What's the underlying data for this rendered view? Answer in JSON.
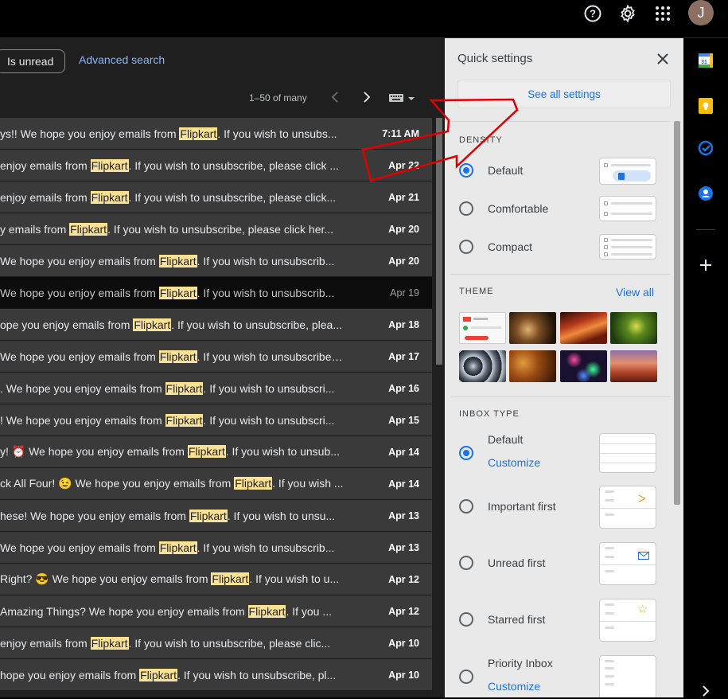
{
  "toolbar": {
    "filter_chip": "Is unread",
    "advanced_search": "Advanced search",
    "pager": "1–50 of many",
    "account_initial": "J"
  },
  "emails": [
    {
      "snippet_pre": "ys!! We hope you enjoy emails from ",
      "brand": "Flipkart",
      "snippet_post": ". If you wish to unsubs...",
      "date": "7:11 AM",
      "read": false
    },
    {
      "snippet_pre": "enjoy emails from ",
      "brand": "Flipkart",
      "snippet_post": ". If you wish to unsubscribe, please click ...",
      "date": "Apr 22",
      "read": false
    },
    {
      "snippet_pre": "enjoy emails from ",
      "brand": "Flipkart",
      "snippet_post": ". If you wish to unsubscribe, please click...",
      "date": "Apr 21",
      "read": false
    },
    {
      "snippet_pre": "y emails from ",
      "brand": "Flipkart",
      "snippet_post": ". If you wish to unsubscribe, please click her...",
      "date": "Apr 20",
      "read": false
    },
    {
      "snippet_pre": "We hope you enjoy emails from ",
      "brand": "Flipkart",
      "snippet_post": ". If you wish to unsubscrib...",
      "date": "Apr 20",
      "read": false
    },
    {
      "snippet_pre": " We hope you enjoy emails from ",
      "brand": "Flipkart",
      "snippet_post": ". If you wish to unsubscrib...",
      "date": "Apr 19",
      "read": true
    },
    {
      "snippet_pre": "ope you enjoy emails from ",
      "brand": "Flipkart",
      "snippet_post": ". If you wish to unsubscribe, plea...",
      "date": "Apr 18",
      "read": false
    },
    {
      "snippet_pre": "We hope you enjoy emails from ",
      "brand": "Flipkart",
      "snippet_post": ". If you wish to unsubscribe,...",
      "date": "Apr 17",
      "read": false
    },
    {
      "snippet_pre": ". We hope you enjoy emails from ",
      "brand": "Flipkart",
      "snippet_post": ". If you wish to unsubscri...",
      "date": "Apr 16",
      "read": false
    },
    {
      "snippet_pre": "! We hope you enjoy emails from ",
      "brand": "Flipkart",
      "snippet_post": ". If you wish to unsubscri...",
      "date": "Apr 15",
      "read": false
    },
    {
      "snippet_pre": "y! ⏰ We hope you enjoy emails from ",
      "brand": "Flipkart",
      "snippet_post": ". If you wish to unsub...",
      "date": "Apr 14",
      "read": false
    },
    {
      "snippet_pre": "ck All Four! 😉 We hope you enjoy emails from ",
      "brand": "Flipkart",
      "snippet_post": ". If you wish ...",
      "date": "Apr 14",
      "read": false
    },
    {
      "snippet_pre": "hese! We hope you enjoy emails from ",
      "brand": "Flipkart",
      "snippet_post": ". If you wish to unsu...",
      "date": "Apr 13",
      "read": false
    },
    {
      "snippet_pre": "We hope you enjoy emails from ",
      "brand": "Flipkart",
      "snippet_post": ". If you wish to unsubscrib...",
      "date": "Apr 13",
      "read": false
    },
    {
      "snippet_pre": " Right? 😎 We hope you enjoy emails from ",
      "brand": "Flipkart",
      "snippet_post": ". If you wish to u...",
      "date": "Apr 12",
      "read": false
    },
    {
      "snippet_pre": " Amazing Things? We hope you enjoy emails from ",
      "brand": "Flipkart",
      "snippet_post": ". If you ...",
      "date": "Apr 12",
      "read": false
    },
    {
      "snippet_pre": " enjoy emails from ",
      "brand": "Flipkart",
      "snippet_post": ". If you wish to unsubscribe, please clic...",
      "date": "Apr 10",
      "read": false
    },
    {
      "snippet_pre": "hope you enjoy emails from ",
      "brand": "Flipkart",
      "snippet_post": ". If you wish to unsubscribe, pl...",
      "date": "Apr 10",
      "read": false
    }
  ],
  "quick_settings": {
    "title": "Quick settings",
    "see_all": "See all settings",
    "density_heading": "DENSITY",
    "density_options": [
      {
        "label": "Default",
        "selected": true
      },
      {
        "label": "Comfortable",
        "selected": false
      },
      {
        "label": "Compact",
        "selected": false
      }
    ],
    "theme_heading": "THEME",
    "view_all": "View all",
    "theme_names": [
      "default-theme",
      "chess-theme",
      "canyon-theme",
      "grasshopper-theme",
      "tubes-theme",
      "autumn-leaves-theme",
      "bokeh-lights-theme",
      "desert-canyon-theme"
    ],
    "inbox_heading": "INBOX TYPE",
    "inbox_options": [
      {
        "label": "Default",
        "selected": true,
        "customize": "Customize"
      },
      {
        "label": "Important first",
        "selected": false
      },
      {
        "label": "Unread first",
        "selected": false
      },
      {
        "label": "Starred first",
        "selected": false
      },
      {
        "label": "Priority Inbox",
        "selected": false,
        "customize": "Customize"
      }
    ]
  },
  "rail": {
    "calendar_day": "31"
  },
  "colors": {
    "accent": "#1a73e8",
    "highlight": "#fde293",
    "arrow": "#e00000"
  }
}
